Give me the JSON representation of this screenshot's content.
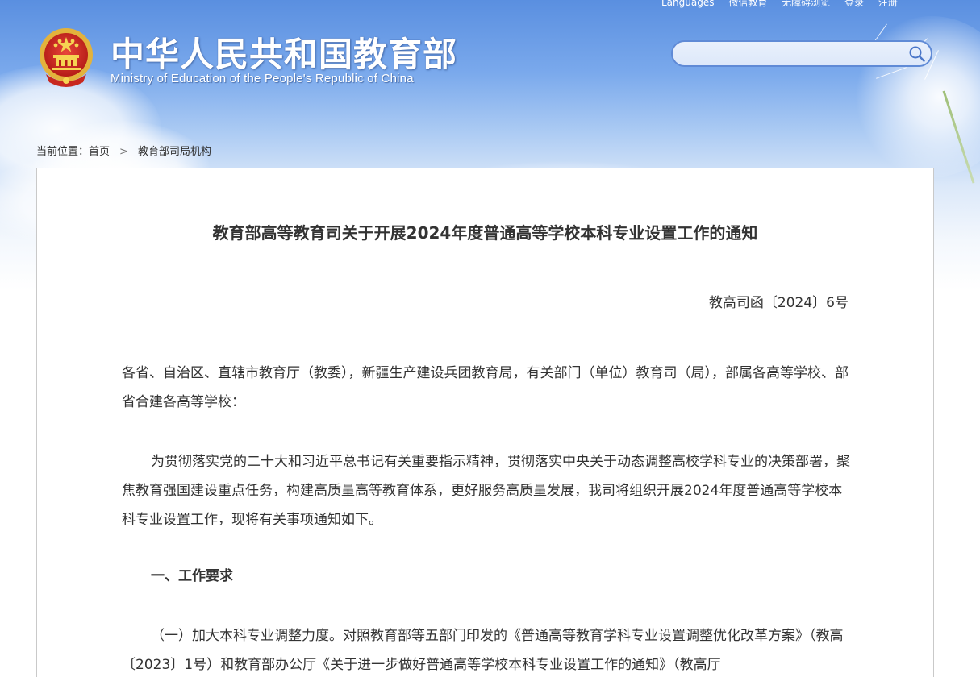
{
  "header": {
    "top_links": [
      "Languages",
      "微信教育",
      "无障碍浏览",
      "登录",
      "注册"
    ],
    "site_title": "中华人民共和国教育部",
    "site_subtitle": "Ministry of Education of the People's Republic of China",
    "search": {
      "value": "",
      "placeholder": ""
    }
  },
  "breadcrumb": {
    "prefix": "当前位置：",
    "items": [
      "首页",
      "教育部司局机构"
    ]
  },
  "article": {
    "title": "教育部高等教育司关于开展2024年度普通高等学校本科专业设置工作的通知",
    "doc_number": "教高司函〔2024〕6号",
    "recipient": "各省、自治区、直辖市教育厅（教委），新疆生产建设兵团教育局，有关部门（单位）教育司（局），部属各高等学校、部省合建各高等学校：",
    "intro": "为贯彻落实党的二十大和习近平总书记有关重要指示精神，贯彻落实中央关于动态调整高校学科专业的决策部署，聚焦教育强国建设重点任务，构建高质量高等教育体系，更好服务高质量发展，我司将组织开展2024年度普通高等学校本科专业设置工作，现将有关事项通知如下。",
    "section_heading": "一、工作要求",
    "item1": "（一）加大本科专业调整力度。对照教育部等五部门印发的《普通高等教育学科专业设置调整优化改革方案》（教高〔2023〕1号）和教育部办公厅《关于进一步做好普通高等学校本科专业设置工作的通知》（教高厅"
  },
  "colors": {
    "sky_top": "#5a8fe0",
    "search_border": "#5f8ad6",
    "text": "#333333",
    "panel_border": "#c9c9c9"
  }
}
